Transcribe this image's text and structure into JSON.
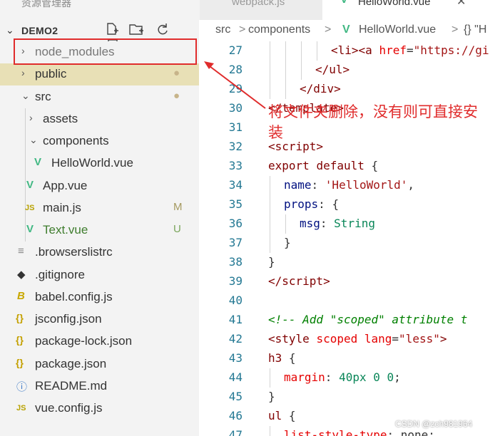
{
  "tabs": {
    "explorer_title": "资源管理器",
    "webpack": "webpack.js",
    "hello": "HelloWorld.vue",
    "close": "✕"
  },
  "explorer": {
    "root": "DEMO2",
    "actions": [
      "new-file",
      "new-folder",
      "refresh",
      "collapse-all"
    ]
  },
  "tree": [
    {
      "label": "node_modules",
      "type": "folder",
      "collapsed": true,
      "selected": false,
      "badge": ""
    },
    {
      "label": "public",
      "type": "folder",
      "collapsed": true,
      "selected": true,
      "badge": "●"
    },
    {
      "label": "src",
      "type": "folder",
      "collapsed": false,
      "selected": false,
      "badge": "●"
    },
    {
      "label": "assets",
      "type": "folder",
      "collapsed": true,
      "badge": ""
    },
    {
      "label": "components",
      "type": "folder",
      "collapsed": false,
      "badge": ""
    },
    {
      "label": "HelloWorld.vue",
      "type": "vue",
      "badge": ""
    },
    {
      "label": "App.vue",
      "type": "vue",
      "badge": ""
    },
    {
      "label": "main.js",
      "type": "js",
      "badge": "M"
    },
    {
      "label": "Text.vue",
      "type": "vue",
      "badge": "U"
    },
    {
      "label": ".browserslistrc",
      "type": "lines",
      "badge": ""
    },
    {
      "label": ".gitignore",
      "type": "git",
      "badge": ""
    },
    {
      "label": "babel.config.js",
      "type": "babel",
      "badge": ""
    },
    {
      "label": "jsconfig.json",
      "type": "json",
      "badge": ""
    },
    {
      "label": "package-lock.json",
      "type": "json",
      "badge": ""
    },
    {
      "label": "package.json",
      "type": "json",
      "badge": ""
    },
    {
      "label": "README.md",
      "type": "info",
      "badge": ""
    },
    {
      "label": "vue.config.js",
      "type": "js",
      "badge": ""
    }
  ],
  "annotation": "将文件夹删除，没有则可直接安装",
  "breadcrumb": [
    "src",
    ">",
    "components",
    ">",
    "HelloWorld.vue",
    ">",
    "{} \"H"
  ],
  "code_lines": [
    {
      "n": "27",
      "html": "<span class=\"tag\">&lt;li&gt;&lt;a</span> <span class=\"attr\">href</span>=<span class=\"str\">\"https://gi</span>"
    },
    {
      "n": "28",
      "html": "<span class=\"tag\">&lt;/ul&gt;</span>"
    },
    {
      "n": "29",
      "html": "<span class=\"tag\">&lt;/div&gt;</span>"
    },
    {
      "n": "30",
      "html": "<span class=\"tag\">&lt;/template&gt;</span>"
    },
    {
      "n": "31",
      "html": ""
    },
    {
      "n": "32",
      "html": "<span class=\"tag\">&lt;script&gt;</span>"
    },
    {
      "n": "33",
      "html": "<span class=\"tag\">export</span> <span class=\"tag\">default</span> <span class=\"plain\">{</span>"
    },
    {
      "n": "34",
      "html": "<span class=\"prop\">name</span><span class=\"plain\">: </span><span class=\"str\">'HelloWorld'</span><span class=\"plain\">,</span>"
    },
    {
      "n": "35",
      "html": "<span class=\"prop\">props</span><span class=\"plain\">: {</span>"
    },
    {
      "n": "36",
      "html": "<span class=\"prop\">msg</span><span class=\"plain\">: </span><span class=\"num\">String</span>"
    },
    {
      "n": "37",
      "html": "<span class=\"plain\">}</span>"
    },
    {
      "n": "38",
      "html": "<span class=\"plain\">}</span>"
    },
    {
      "n": "39",
      "html": "<span class=\"tag\">&lt;/script&gt;</span>"
    },
    {
      "n": "40",
      "html": ""
    },
    {
      "n": "41",
      "html": "<span class=\"cmt\">&lt;!-- Add \"scoped\" attribute t</span>"
    },
    {
      "n": "42",
      "html": "<span class=\"tag\">&lt;style</span> <span class=\"attr\">scoped</span> <span class=\"attr\">lang</span>=<span class=\"str\">\"less\"</span><span class=\"tag\">&gt;</span>"
    },
    {
      "n": "43",
      "html": "<span class=\"css-sel\">h3</span> <span class=\"plain\">{</span>"
    },
    {
      "n": "44",
      "html": "<span class=\"css-prop\">margin</span><span class=\"plain\">: </span><span class=\"num\">40px</span> <span class=\"num\">0</span> <span class=\"num\">0</span><span class=\"plain\">;</span>"
    },
    {
      "n": "45",
      "html": "<span class=\"plain\">}</span>"
    },
    {
      "n": "46",
      "html": "<span class=\"css-sel\">ul</span> <span class=\"plain\">{</span>"
    },
    {
      "n": "47",
      "html": "<span class=\"css-prop\">list-style-type</span><span class=\"plain\">: none;</span>"
    }
  ],
  "watermark": "CSDN @zch981964"
}
